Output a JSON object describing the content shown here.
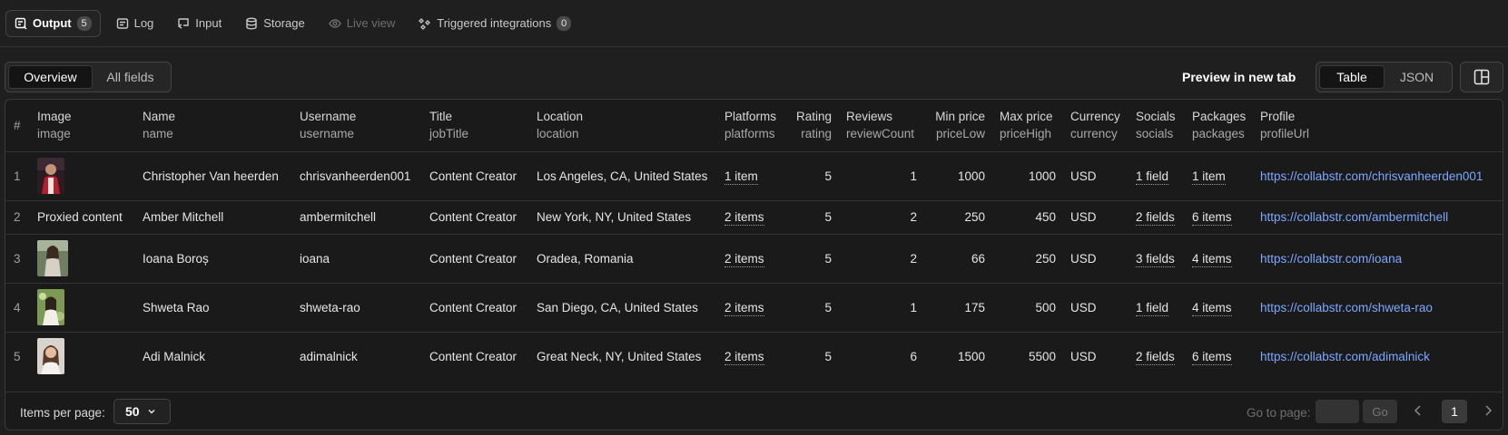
{
  "tabs": [
    {
      "label": "Output",
      "badge": "5",
      "icon": "output-icon"
    },
    {
      "label": "Log",
      "icon": "log-icon"
    },
    {
      "label": "Input",
      "icon": "input-icon"
    },
    {
      "label": "Storage",
      "icon": "storage-icon"
    },
    {
      "label": "Live view",
      "icon": "live-view-icon"
    },
    {
      "label": "Triggered integrations",
      "badge": "0",
      "icon": "integrations-icon"
    }
  ],
  "view_toggle": {
    "overview": "Overview",
    "all_fields": "All fields"
  },
  "preview_link": "Preview in new tab",
  "format_toggle": {
    "table": "Table",
    "json": "JSON"
  },
  "table": {
    "index_header": "#",
    "columns": [
      {
        "label": "Image",
        "key": "image"
      },
      {
        "label": "Name",
        "key": "name"
      },
      {
        "label": "Username",
        "key": "username"
      },
      {
        "label": "Title",
        "key": "jobTitle"
      },
      {
        "label": "Location",
        "key": "location"
      },
      {
        "label": "Platforms",
        "key": "platforms"
      },
      {
        "label": "Rating",
        "key": "rating"
      },
      {
        "label": "Reviews",
        "key": "reviewCount"
      },
      {
        "label": "Min price",
        "key": "priceLow"
      },
      {
        "label": "Max price",
        "key": "priceHigh"
      },
      {
        "label": "Currency",
        "key": "currency"
      },
      {
        "label": "Socials",
        "key": "socials"
      },
      {
        "label": "Packages",
        "key": "packages"
      },
      {
        "label": "Profile",
        "key": "profileUrl"
      }
    ],
    "rows": [
      {
        "idx": "1",
        "image": "",
        "name": "Christopher Van heerden",
        "username": "chrisvanheerden001",
        "jobTitle": "Content Creator",
        "location": "Los Angeles, CA, United States",
        "platforms": "1 item",
        "rating": "5",
        "reviewCount": "1",
        "priceLow": "1000",
        "priceHigh": "1000",
        "currency": "USD",
        "socials": "1 field",
        "packages": "1 item",
        "profileUrl": "https://collabstr.com/chrisvanheerden001"
      },
      {
        "idx": "2",
        "image": "Proxied content",
        "name": "Amber Mitchell",
        "username": "ambermitchell",
        "jobTitle": "Content Creator",
        "location": "New York, NY, United States",
        "platforms": "2 items",
        "rating": "5",
        "reviewCount": "2",
        "priceLow": "250",
        "priceHigh": "450",
        "currency": "USD",
        "socials": "2 fields",
        "packages": "6 items",
        "profileUrl": "https://collabstr.com/ambermitchell"
      },
      {
        "idx": "3",
        "image": "",
        "name": "Ioana Boroș",
        "username": "ioana",
        "jobTitle": "Content Creator",
        "location": "Oradea, Romania",
        "platforms": "2 items",
        "rating": "5",
        "reviewCount": "2",
        "priceLow": "66",
        "priceHigh": "250",
        "currency": "USD",
        "socials": "3 fields",
        "packages": "4 items",
        "profileUrl": "https://collabstr.com/ioana"
      },
      {
        "idx": "4",
        "image": "",
        "name": "Shweta Rao",
        "username": "shweta-rao",
        "jobTitle": "Content Creator",
        "location": "San Diego, CA, United States",
        "platforms": "2 items",
        "rating": "5",
        "reviewCount": "1",
        "priceLow": "175",
        "priceHigh": "500",
        "currency": "USD",
        "socials": "1 field",
        "packages": "4 items",
        "profileUrl": "https://collabstr.com/shweta-rao"
      },
      {
        "idx": "5",
        "image": "",
        "name": "Adi Malnick",
        "username": "adimalnick",
        "jobTitle": "Content Creator",
        "location": "Great Neck, NY, United States",
        "platforms": "2 items",
        "rating": "5",
        "reviewCount": "6",
        "priceLow": "1500",
        "priceHigh": "5500",
        "currency": "USD",
        "socials": "2 fields",
        "packages": "6 items",
        "profileUrl": "https://collabstr.com/adimalnick"
      }
    ]
  },
  "footer": {
    "items_per_page_label": "Items per page:",
    "items_per_page_value": "50",
    "goto_label": "Go to page:",
    "goto_button": "Go",
    "current_page": "1"
  },
  "colors": {
    "background": "#1f1f1f",
    "link": "#7ea7ff",
    "border": "#3a3a3a"
  }
}
